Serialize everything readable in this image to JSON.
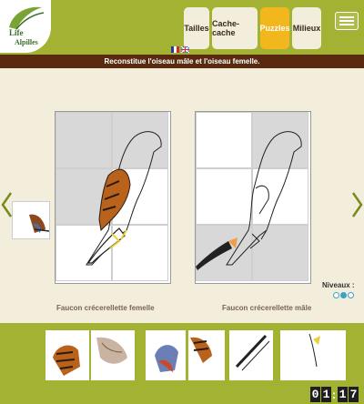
{
  "logo": {
    "line1": "Life",
    "line2": "Alpilles"
  },
  "tabs": [
    {
      "label": "Tailles",
      "active": false
    },
    {
      "label": "Cache-cache",
      "active": false
    },
    {
      "label": "Puzzles",
      "active": true
    },
    {
      "label": "Milieux",
      "active": false
    }
  ],
  "languages": [
    "fr",
    "en"
  ],
  "banner": "Reconstitue l'oiseau mâle et l'oiseau femelle.",
  "puzzles": [
    {
      "caption": "Faucon crécerellette femelle"
    },
    {
      "caption": "Faucon crécerellette mâle"
    }
  ],
  "levels": {
    "label": "Niveaux :",
    "count": 3,
    "selected": 2
  },
  "timer": {
    "d1": "0",
    "d2": "1",
    "d3": "1",
    "d4": "7",
    "separator": ":"
  },
  "colors": {
    "green": "#a4b233",
    "brown": "#5a2a10",
    "cream": "#f3eddc",
    "orange": "#f2b71d"
  }
}
